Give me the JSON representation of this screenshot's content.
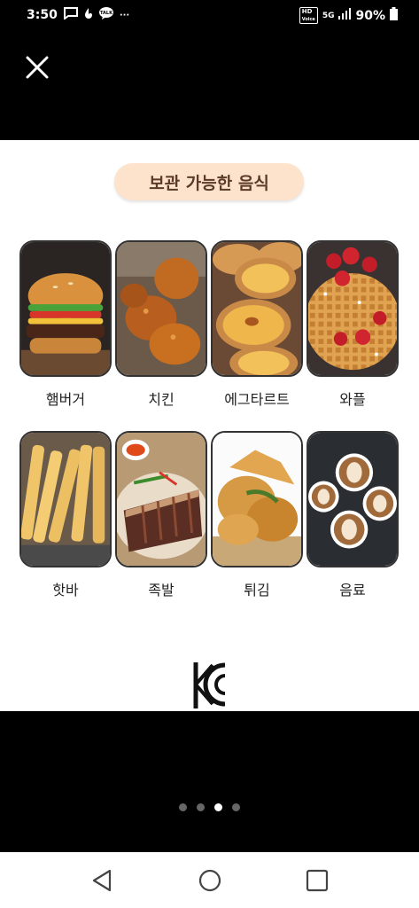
{
  "status_bar": {
    "time": "3:50",
    "battery": "90%",
    "hd_top": "HD",
    "hd_bottom": "Voice",
    "network": "5G",
    "icons": [
      "message-icon",
      "notification-icon",
      "kakaotalk-icon",
      "more-icon",
      "signal-icon",
      "battery-icon"
    ]
  },
  "modal": {
    "close_icon": "close-icon"
  },
  "sheet": {
    "title": "보관 가능한 음식",
    "foods": [
      {
        "label": "햄버거",
        "image": "hamburger-image"
      },
      {
        "label": "치킨",
        "image": "fried-chicken-image"
      },
      {
        "label": "에그타르트",
        "image": "egg-tart-image"
      },
      {
        "label": "와플",
        "image": "waffle-image"
      },
      {
        "label": "핫바",
        "image": "fish-cake-bar-image"
      },
      {
        "label": "족발",
        "image": "jokbal-image"
      },
      {
        "label": "튀김",
        "image": "tempura-image"
      },
      {
        "label": "음료",
        "image": "coffee-image"
      }
    ],
    "certification_mark": "KC"
  },
  "pager": {
    "count": 4,
    "active_index": 2
  },
  "nav_bar": {
    "buttons": [
      "back-icon",
      "home-icon",
      "recents-icon"
    ]
  },
  "colors": {
    "pill_bg": "#fde3cc",
    "pill_text": "#5b3a2a",
    "tile_border": "#333333"
  }
}
